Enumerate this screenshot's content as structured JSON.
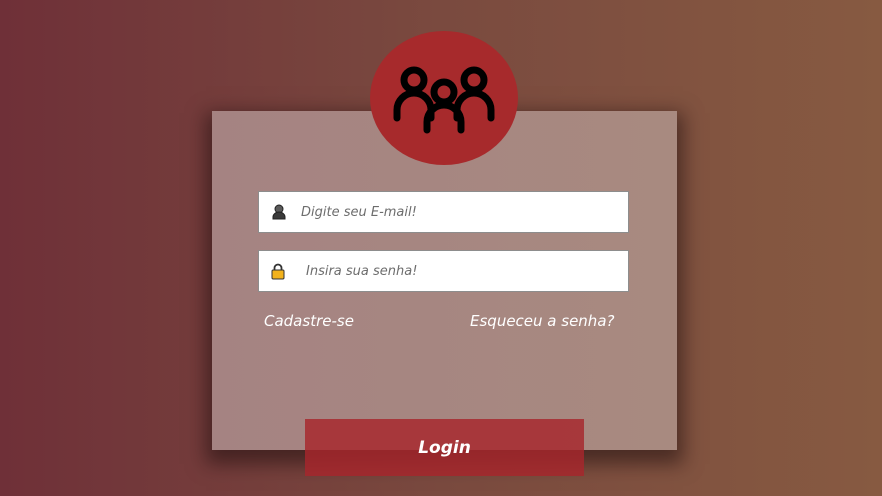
{
  "login_form": {
    "email": {
      "value": "",
      "placeholder": "Digite seu E-mail!",
      "icon": "user-icon"
    },
    "password": {
      "value": "",
      "placeholder": "Insira sua senha!",
      "icon": "lock-icon"
    },
    "signup_link": "Cadastre-se",
    "forgot_link": "Esqueceu a senha?",
    "login_button": "Login"
  },
  "header": {
    "icon": "group-users-icon"
  },
  "colors": {
    "background_left": "#6f3038",
    "background_right": "#875a41",
    "card": "#a58382",
    "accent": "#a72a2c",
    "button": "#a7262c"
  }
}
